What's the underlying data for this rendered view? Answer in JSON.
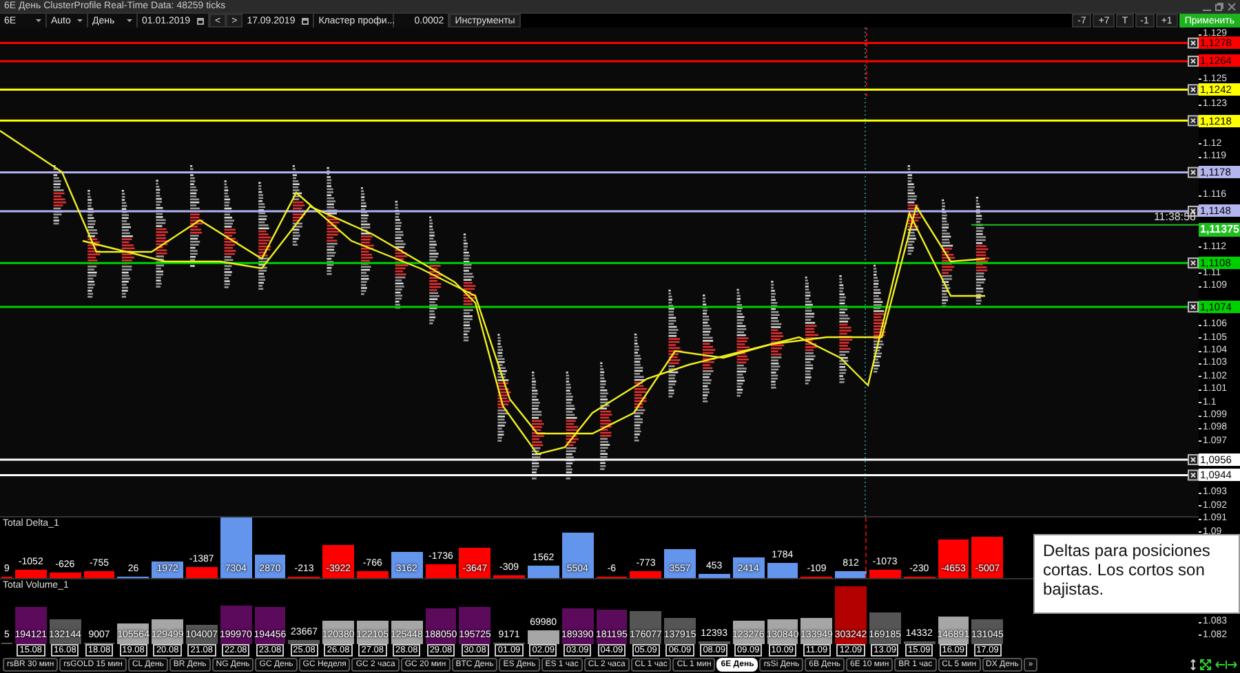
{
  "window": {
    "title": "6E День ClusterProfile Real-Time Data: 48259 ticks"
  },
  "toolbar": {
    "instrument": "6E",
    "scale": "Auto",
    "timeframe": "День",
    "date_from": "01.01.2019",
    "prev": "<",
    "next": ">",
    "date_to": "17.09.2019",
    "indicator": "Кластер профи...",
    "step": "0.0002",
    "tools": "Инструменты",
    "right_buttons": [
      "-7",
      "+7",
      "T",
      "-1",
      "+1"
    ],
    "apply": "Применить"
  },
  "chart": {
    "price_levels": [
      {
        "label": "1,1278",
        "color": "#ff0000"
      },
      {
        "label": "1,1264",
        "color": "#ff0000"
      },
      {
        "label": "1,1242",
        "color": "#ffff00"
      },
      {
        "label": "1,1218",
        "color": "#ffff00"
      },
      {
        "label": "1,1178",
        "color": "#b4b4f0"
      },
      {
        "label": "1,1148",
        "color": "#b4b4f0"
      },
      {
        "label": "1,1108",
        "color": "#00d000"
      },
      {
        "label": "1,1074",
        "color": "#00d000"
      },
      {
        "label": "1,0956",
        "color": "#ffffff"
      },
      {
        "label": "1,0944",
        "color": "#ffffff"
      }
    ],
    "current_price": {
      "label": "1,11375",
      "time": "11:38:58"
    },
    "axis_ticks": [
      "1.129",
      "1.125",
      "1.123",
      "1.12",
      "1.119",
      "1.116",
      "1.112",
      "1.11",
      "1.109",
      "1.106",
      "1.105",
      "1.104",
      "1.103",
      "1.102",
      "1.101",
      "1.1",
      "1.099",
      "1.098",
      "1.097",
      "1.093",
      "1.092",
      "1.091",
      "1.09",
      "1.083",
      "1.082"
    ]
  },
  "delta_panel": {
    "title": "Total Delta_1",
    "bars": [
      {
        "value": "9",
        "color": "#ff0000"
      },
      {
        "value": "-1052",
        "color": "#ff0000"
      },
      {
        "value": "-626",
        "color": "#ff0000"
      },
      {
        "value": "-755",
        "color": "#ff0000"
      },
      {
        "value": "26",
        "color": "#6495ed"
      },
      {
        "value": "1972",
        "color": "#6495ed"
      },
      {
        "value": "-1387",
        "color": "#ff0000"
      },
      {
        "value": "7304",
        "color": "#6495ed"
      },
      {
        "value": "2870",
        "color": "#6495ed"
      },
      {
        "value": "-213",
        "color": "#ff0000"
      },
      {
        "value": "-3922",
        "color": "#ff0000"
      },
      {
        "value": "-766",
        "color": "#ff0000"
      },
      {
        "value": "3162",
        "color": "#6495ed"
      },
      {
        "value": "-1736",
        "color": "#ff0000"
      },
      {
        "value": "-3647",
        "color": "#ff0000"
      },
      {
        "value": "-309",
        "color": "#ff0000"
      },
      {
        "value": "1562",
        "color": "#6495ed"
      },
      {
        "value": "5504",
        "color": "#6495ed"
      },
      {
        "value": "-6",
        "color": "#ff0000"
      },
      {
        "value": "-773",
        "color": "#ff0000"
      },
      {
        "value": "3557",
        "color": "#6495ed"
      },
      {
        "value": "453",
        "color": "#6495ed"
      },
      {
        "value": "2414",
        "color": "#6495ed"
      },
      {
        "value": "1784",
        "color": "#6495ed"
      },
      {
        "value": "-109",
        "color": "#ff0000"
      },
      {
        "value": "812",
        "color": "#6495ed"
      },
      {
        "value": "-1073",
        "color": "#ff0000"
      },
      {
        "value": "-230",
        "color": "#ff0000"
      },
      {
        "value": "-4653",
        "color": "#ff0000"
      },
      {
        "value": "-5007",
        "color": "#ff0000"
      }
    ]
  },
  "volume_panel": {
    "title": "Total Volume_1",
    "bars": [
      {
        "value": "5",
        "color": "#555555"
      },
      {
        "value": "194121",
        "color": "#5c0a5c"
      },
      {
        "value": "132144",
        "color": "#555555"
      },
      {
        "value": "9007",
        "color": "#555555"
      },
      {
        "value": "105564",
        "color": "#a6a6a6"
      },
      {
        "value": "129499",
        "color": "#a6a6a6"
      },
      {
        "value": "104007",
        "color": "#555555"
      },
      {
        "value": "199970",
        "color": "#5c0a5c"
      },
      {
        "value": "194456",
        "color": "#5c0a5c"
      },
      {
        "value": "23667",
        "color": "#555555"
      },
      {
        "value": "120380",
        "color": "#a6a6a6"
      },
      {
        "value": "122105",
        "color": "#a6a6a6"
      },
      {
        "value": "125448",
        "color": "#a6a6a6"
      },
      {
        "value": "188050",
        "color": "#5c0a5c"
      },
      {
        "value": "195725",
        "color": "#5c0a5c"
      },
      {
        "value": "9171",
        "color": "#555555"
      },
      {
        "value": "69980",
        "color": "#a6a6a6"
      },
      {
        "value": "189390",
        "color": "#5c0a5c"
      },
      {
        "value": "181195",
        "color": "#5c0a5c"
      },
      {
        "value": "176077",
        "color": "#555555"
      },
      {
        "value": "137915",
        "color": "#555555"
      },
      {
        "value": "12393",
        "color": "#555555"
      },
      {
        "value": "123276",
        "color": "#a6a6a6"
      },
      {
        "value": "130840",
        "color": "#a6a6a6"
      },
      {
        "value": "133949",
        "color": "#a6a6a6"
      },
      {
        "value": "303242",
        "color": "#b30000"
      },
      {
        "value": "169185",
        "color": "#555555"
      },
      {
        "value": "14332",
        "color": "#555555"
      },
      {
        "value": "146891",
        "color": "#a6a6a6"
      },
      {
        "value": "131045",
        "color": "#555555"
      }
    ]
  },
  "dates": [
    "15.08",
    "16.08",
    "18.08",
    "19.08",
    "20.08",
    "21.08",
    "22.08",
    "23.08",
    "25.08",
    "26.08",
    "27.08",
    "28.08",
    "29.08",
    "30.08",
    "01.09",
    "02.09",
    "03.09",
    "04.09",
    "05.09",
    "06.09",
    "08.09",
    "09.09",
    "10.09",
    "11.09",
    "12.09",
    "13.09",
    "15.09",
    "16.09",
    "17.09"
  ],
  "note": {
    "text": "Deltas para posiciones cortas. Los cortos son bajistas."
  },
  "tabs": [
    {
      "label": "rsBR 30 мин",
      "selected": false
    },
    {
      "label": "rsGOLD 15 мин",
      "selected": false
    },
    {
      "label": "CL День",
      "selected": false
    },
    {
      "label": "BR День",
      "selected": false
    },
    {
      "label": "NG День",
      "selected": false
    },
    {
      "label": "GC День",
      "selected": false
    },
    {
      "label": "GC Неделя",
      "selected": false
    },
    {
      "label": "GC 2 часа",
      "selected": false
    },
    {
      "label": "GC 20 мин",
      "selected": false
    },
    {
      "label": "BTC День",
      "selected": false
    },
    {
      "label": "ES День",
      "selected": false
    },
    {
      "label": "ES 1 час",
      "selected": false
    },
    {
      "label": "CL 2 часа",
      "selected": false
    },
    {
      "label": "CL 1 час",
      "selected": false
    },
    {
      "label": "CL 1 мин",
      "selected": false
    },
    {
      "label": "6E День",
      "selected": true
    },
    {
      "label": "rsSi День",
      "selected": false
    },
    {
      "label": "6B День",
      "selected": false
    },
    {
      "label": "6E 10 мин",
      "selected": false
    },
    {
      "label": "BR 1 час",
      "selected": false
    },
    {
      "label": "CL 5 мин",
      "selected": false
    },
    {
      "label": "DX День",
      "selected": false
    },
    {
      "label": "»",
      "selected": false
    }
  ]
}
